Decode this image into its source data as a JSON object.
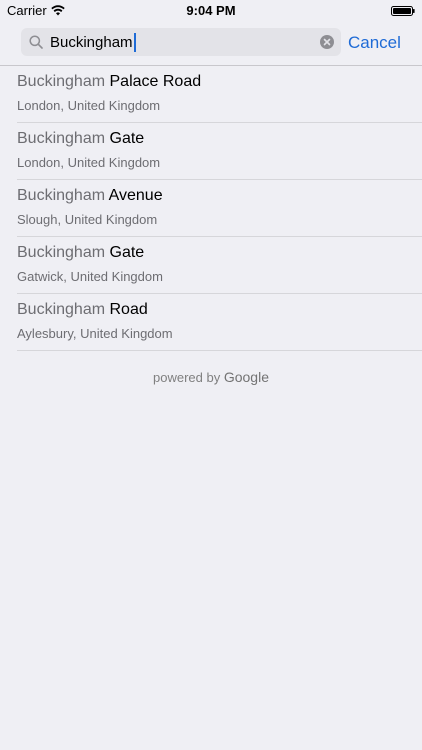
{
  "status_bar": {
    "carrier": "Carrier",
    "time": "9:04 PM"
  },
  "search": {
    "value": "Buckingham",
    "cancel_label": "Cancel"
  },
  "results": [
    {
      "match": "Buckingham",
      "rest": " Palace Road",
      "subtitle": "London, United Kingdom"
    },
    {
      "match": "Buckingham",
      "rest": " Gate",
      "subtitle": "London, United Kingdom"
    },
    {
      "match": "Buckingham",
      "rest": " Avenue",
      "subtitle": "Slough, United Kingdom"
    },
    {
      "match": "Buckingham",
      "rest": " Gate",
      "subtitle": "Gatwick, United Kingdom"
    },
    {
      "match": "Buckingham",
      "rest": " Road",
      "subtitle": "Aylesbury, United Kingdom"
    }
  ],
  "attribution": {
    "prefix": "powered by",
    "brand": "Google"
  },
  "colors": {
    "accent": "#1f6bd6",
    "background": "#efeff4",
    "secondary_text": "#6d6d72"
  }
}
